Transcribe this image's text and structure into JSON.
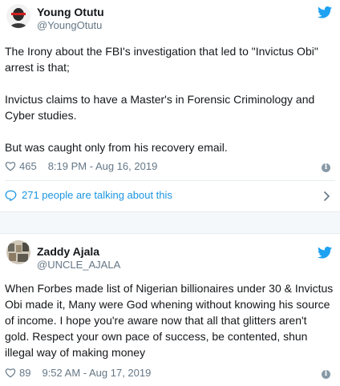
{
  "tweets": [
    {
      "name": "Young Otutu",
      "handle": "@YoungOtutu",
      "paragraphs": [
        "The Irony about the FBI's investigation that led to \"Invictus Obi\" arrest is that;",
        "Invictus claims to have a Master's in Forensic Criminology and Cyber studies.",
        "But was caught only from his recovery email."
      ],
      "likes": "465",
      "timestamp": "8:19 PM - Aug 16, 2019",
      "talking": "271 people are talking about this",
      "icons": [
        "avatar",
        "twitter-bird-icon",
        "heart-icon",
        "info-icon",
        "speech-bubble-icon",
        "chevron-right-icon"
      ]
    },
    {
      "name": "Zaddy Ajala",
      "handle": "@UNCLE_AJALA",
      "paragraphs": [
        "When Forbes made list of Nigerian billionaires under 30 & Invictus Obi made it, Many were God whening without knowing his source of income. I hope you're aware now that all that glitters aren't gold. Respect your own pace of success, be contented, shun illegal way of making money"
      ],
      "likes": "89",
      "timestamp": "9:52 AM - Aug 17, 2019",
      "icons": [
        "avatar",
        "twitter-bird-icon",
        "heart-icon",
        "info-icon"
      ]
    }
  ],
  "colors": {
    "twitter_blue": "#1da1f2",
    "link_blue": "#1b95e0",
    "text": "#14171a",
    "muted": "#657786",
    "divider": "#e6ecf0"
  }
}
